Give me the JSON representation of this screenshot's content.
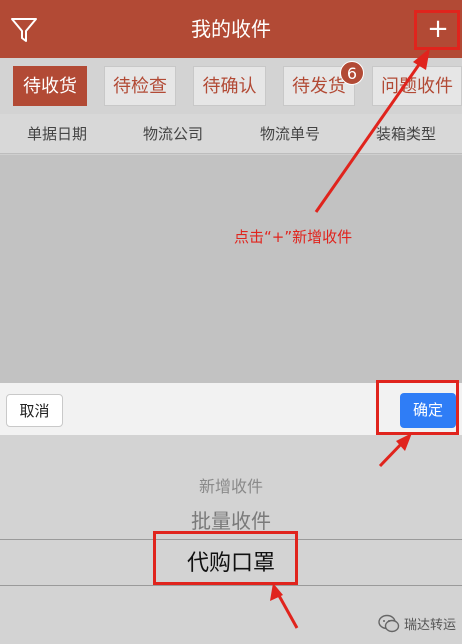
{
  "header": {
    "title": "我的收件",
    "add_label": "+",
    "filter_icon": "filter-icon",
    "bg_color": "#b24a35"
  },
  "tabs": [
    {
      "label": "待收货",
      "active": true
    },
    {
      "label": "待检查",
      "active": false
    },
    {
      "label": "待确认",
      "active": false
    },
    {
      "label": "待发货",
      "active": false,
      "badge": "6"
    },
    {
      "label": "问题收件",
      "active": false
    }
  ],
  "columns": [
    "单据日期",
    "物流公司",
    "物流单号",
    "装箱类型"
  ],
  "annotation": {
    "text": "点击“+”新增收件",
    "color": "#e0241d"
  },
  "sheet": {
    "cancel_label": "取消",
    "confirm_label": "确定",
    "confirm_color": "#2f7df6"
  },
  "picker": {
    "options": [
      "新增收件",
      "批量收件",
      "代购口罩"
    ],
    "selected": "代购口罩"
  },
  "watermark": {
    "text": "瑞达转运",
    "icon": "wechat-icon"
  }
}
